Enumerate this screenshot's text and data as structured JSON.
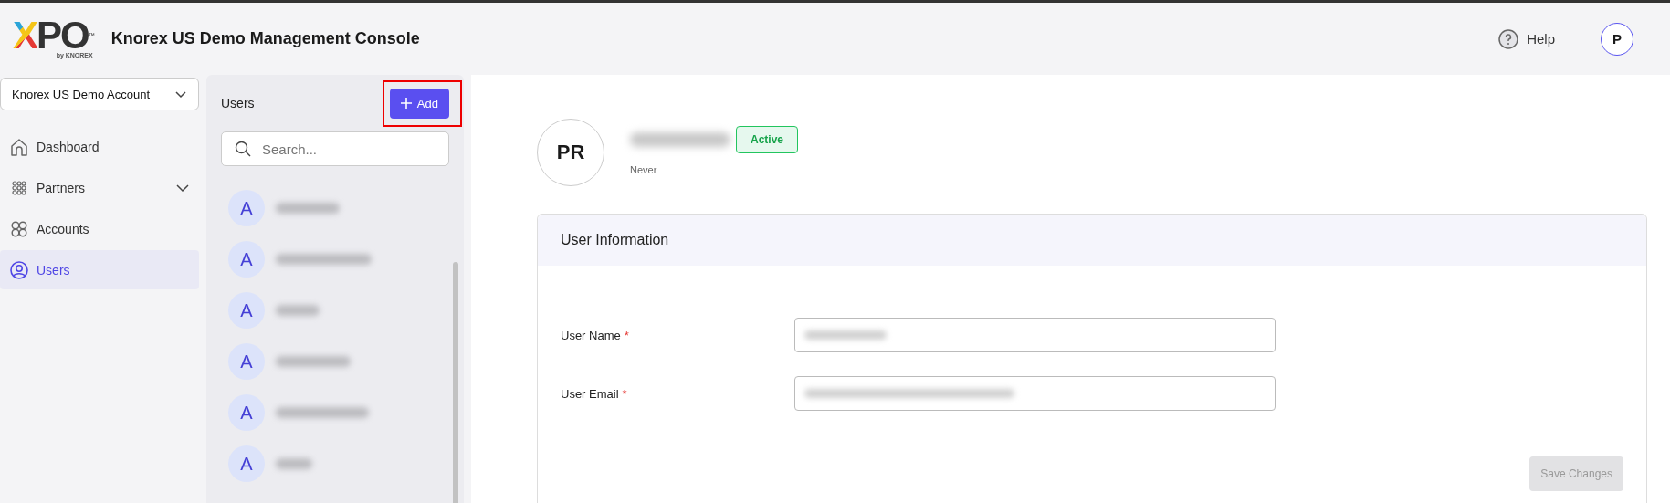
{
  "header": {
    "logo": {
      "wordmark": "XPO",
      "trademark": "™",
      "tagline": "by KNOREX"
    },
    "title": "Knorex US Demo Management Console",
    "help": "Help",
    "avatar": "P"
  },
  "sidebar": {
    "account_select": "Knorex US Demo Account",
    "items": [
      {
        "label": "Dashboard",
        "selected": false,
        "expandable": false
      },
      {
        "label": "Partners",
        "selected": false,
        "expandable": true
      },
      {
        "label": "Accounts",
        "selected": false,
        "expandable": false
      },
      {
        "label": "Users",
        "selected": true,
        "expandable": false
      }
    ]
  },
  "users_panel": {
    "title": "Users",
    "add_button": "Add",
    "highlighted": true,
    "search": {
      "placeholder": "Search..."
    },
    "users": [
      {
        "avatar": "A"
      },
      {
        "avatar": "A"
      },
      {
        "avatar": "A"
      },
      {
        "avatar": "A"
      },
      {
        "avatar": "A"
      },
      {
        "avatar": "A"
      }
    ]
  },
  "profile": {
    "avatar": "PR",
    "status": "Active",
    "last_login": "Never"
  },
  "card": {
    "title": "User Information",
    "fields": [
      {
        "label": "User Name",
        "required_mark": "*"
      },
      {
        "label": "User Email",
        "required_mark": "*"
      }
    ],
    "save_button": {
      "label": "Save Changes",
      "disabled": true
    }
  }
}
